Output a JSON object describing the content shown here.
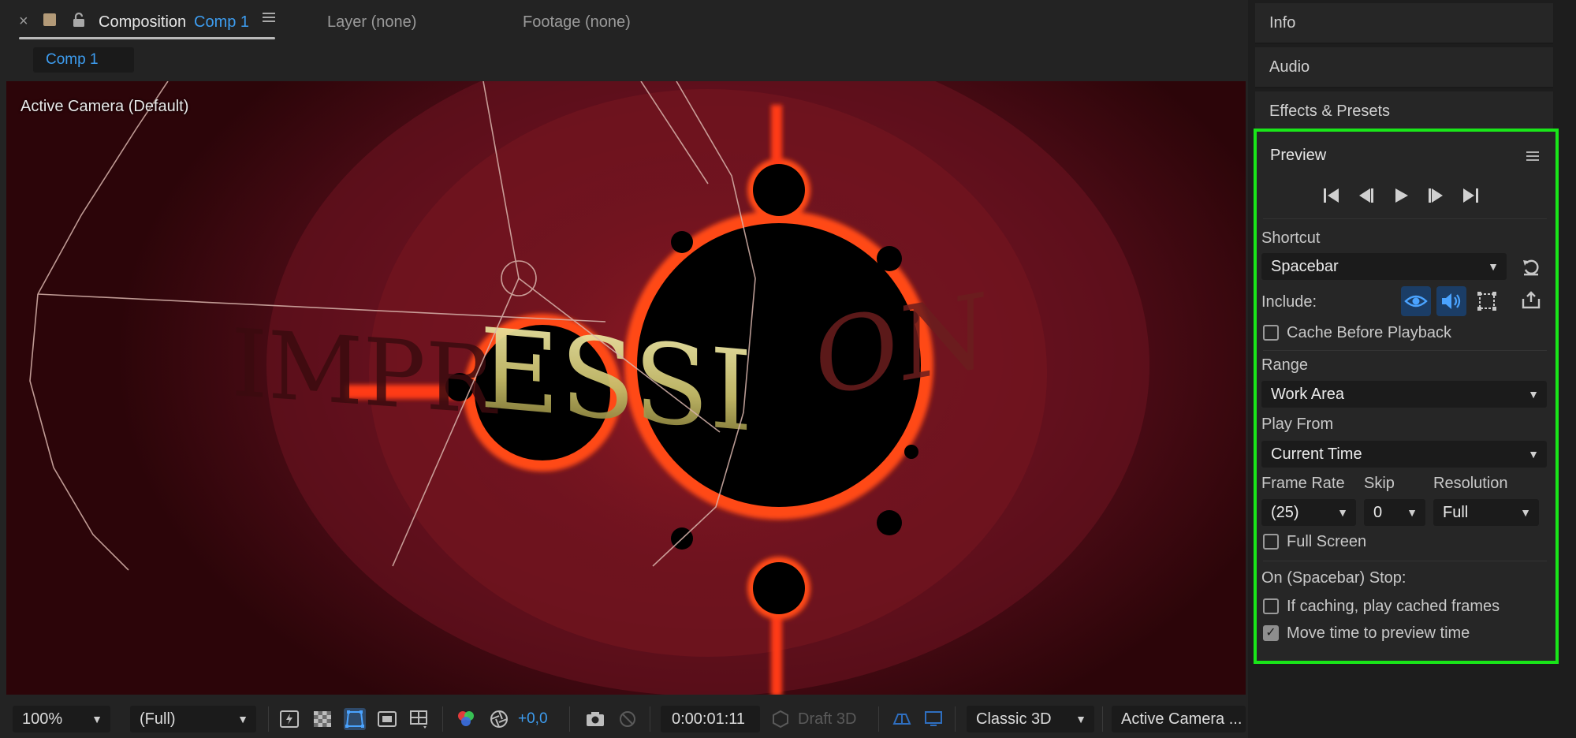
{
  "composition_panel": {
    "tabs": {
      "close_glyph": "×",
      "composition_word": "Composition",
      "comp_name": "Comp 1",
      "layer_tab": "Layer (none)",
      "footage_tab": "Footage (none)"
    },
    "flowchart_chip": "Comp 1",
    "viewer": {
      "camera_label": "Active Camera (Default)",
      "overlay_text": "IMPRESSION",
      "colors": {
        "background": "#5e0f1b",
        "fractal_edge": "#ff5a1f",
        "set_fill": "#000000",
        "text_gold": "#d8d08a"
      }
    },
    "toolbar": {
      "zoom": "100%",
      "resolution": "(Full)",
      "exposure": "+0,0",
      "timecode": "0:00:01:11",
      "draft_3d": "Draft 3D",
      "renderer": "Classic 3D",
      "view": "Active Camera ...",
      "icons": [
        "fast-previews-icon",
        "transparency-grid-icon",
        "mask-path-icon",
        "region-of-interest-icon",
        "grid-guides-icon",
        "color-channels-icon",
        "exposure-reset-icon",
        "snapshot-icon",
        "show-snapshot-icon",
        "draft-3d-icon",
        "3d-ground-plane-icon",
        "extended-viewer-icon"
      ]
    }
  },
  "right_panels": {
    "info": "Info",
    "audio": "Audio",
    "effects_presets": "Effects & Presets"
  },
  "preview": {
    "title": "Preview",
    "shortcut_label": "Shortcut",
    "shortcut_value": "Spacebar",
    "include_label": "Include:",
    "cache_before_playback": "Cache Before Playback",
    "cache_before_playback_checked": false,
    "range_label": "Range",
    "range_value": "Work Area",
    "play_from_label": "Play From",
    "play_from_value": "Current Time",
    "frame_rate_label": "Frame Rate",
    "frame_rate_value": "(25)",
    "skip_label": "Skip",
    "skip_value": "0",
    "resolution_label": "Resolution",
    "resolution_value": "Full",
    "full_screen": "Full Screen",
    "full_screen_checked": false,
    "on_stop_label": "On (Spacebar) Stop:",
    "if_caching": "If caching, play cached frames",
    "if_caching_checked": false,
    "move_time": "Move time to preview time",
    "move_time_checked": true,
    "highlight_color": "#19e619",
    "accent_color": "#2f7fd8"
  }
}
